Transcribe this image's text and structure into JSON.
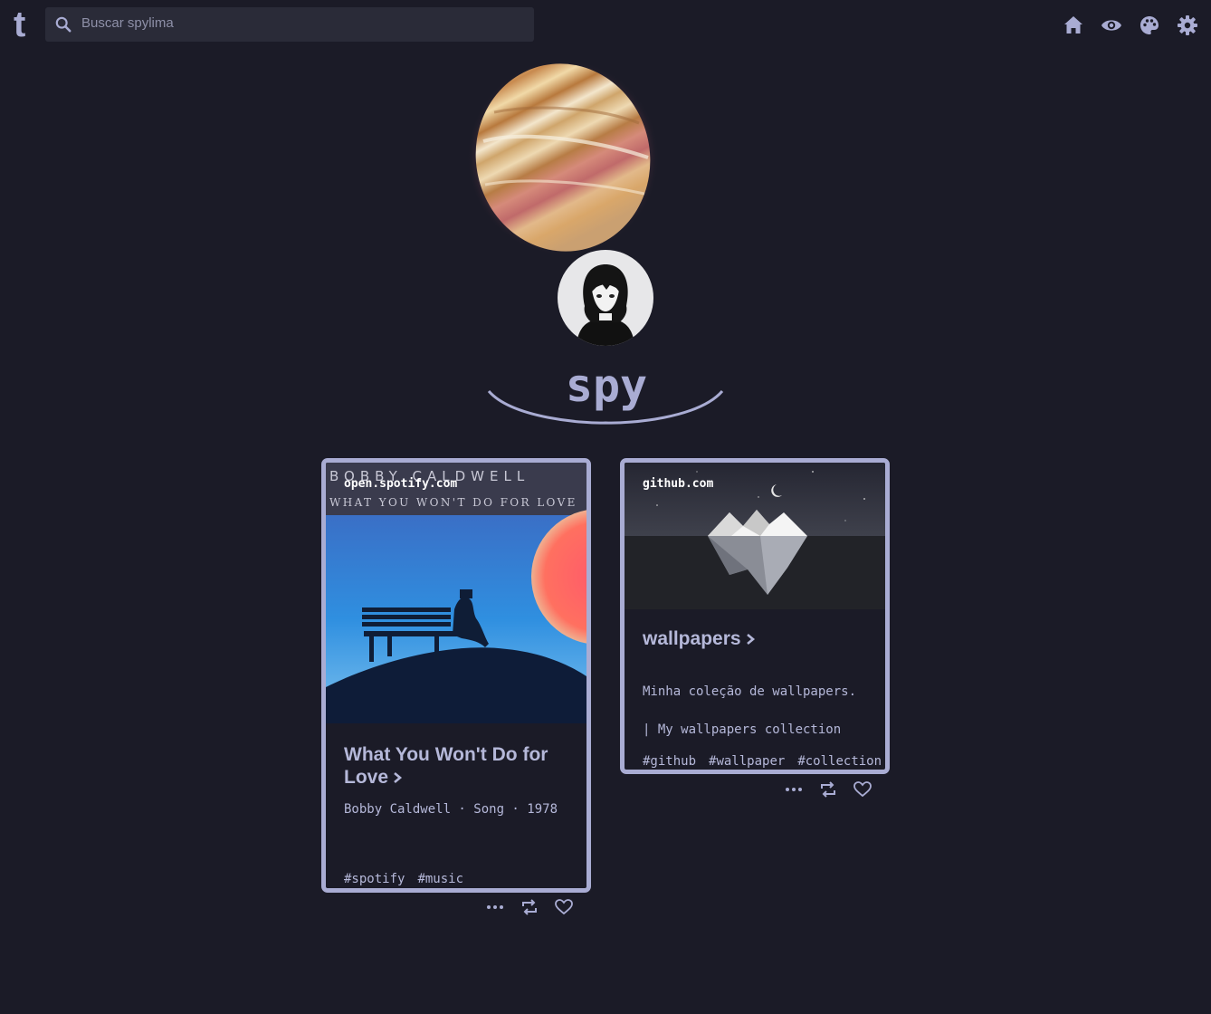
{
  "topbar": {
    "logo": "t",
    "search_placeholder": "Buscar spylima",
    "nav_icons": [
      "home-icon",
      "eye-icon",
      "palette-icon",
      "gear-icon"
    ]
  },
  "header": {
    "blog_title": "spy"
  },
  "posts": [
    {
      "domain": "open.spotify.com",
      "cover_text_line1": "BOBBY CALDWELL",
      "cover_text_line2": "WHAT YOU WON'T DO FOR LOVE",
      "title_line1": "What You Won't Do for",
      "title_line2": "Love",
      "description": "Bobby Caldwell · Song · 1978",
      "tags": [
        "#spotify",
        "#music"
      ]
    },
    {
      "domain": "github.com",
      "title": "wallpapers",
      "description_line1": "Minha coleção de wallpapers.",
      "description_line2": "| My wallpapers collection",
      "tags": [
        "#github",
        "#wallpaper",
        "#collection"
      ]
    }
  ],
  "colors": {
    "background": "#1b1b27",
    "accent": "#a9acd3",
    "text": "#b5b8d9",
    "search_bg": "#2a2b38"
  }
}
